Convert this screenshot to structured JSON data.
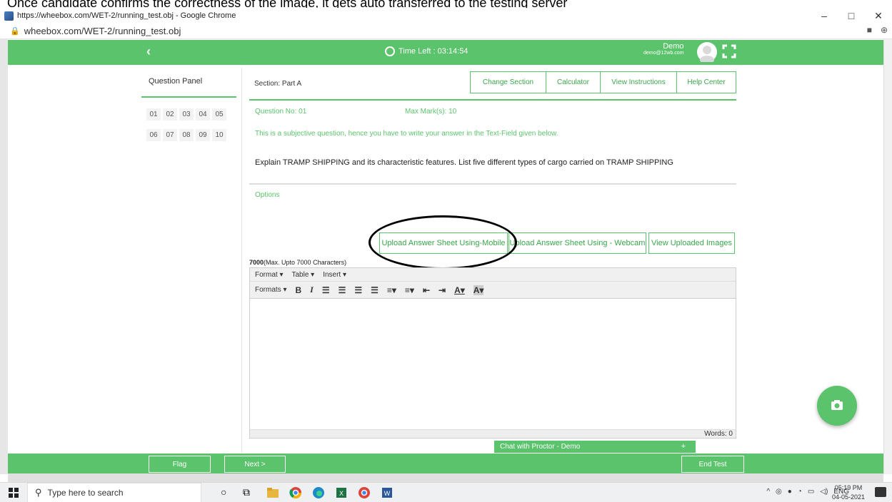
{
  "caption": "Once candidate confirms the correctness of the image, it gets auto transferred to the testing server",
  "window": {
    "title": "https://wheebox.com/WET-2/running_test.obj - Google Chrome",
    "minimize": "–",
    "maximize": "□",
    "close": "✕"
  },
  "address": {
    "url": "wheebox.com/WET-2/running_test.obj"
  },
  "header": {
    "back": "‹",
    "timer_label": "Time Left : 03:14:54",
    "user_name": "Demo",
    "user_email": "demo@12wb.com"
  },
  "question_panel": {
    "title": "Question Panel",
    "numbers": [
      "01",
      "02",
      "03",
      "04",
      "05",
      "06",
      "07",
      "08",
      "09",
      "10"
    ]
  },
  "section": {
    "label": "Section: Part A"
  },
  "top_buttons": {
    "change_section": "Change Section",
    "calculator": "Calculator",
    "view_instructions": "View Instructions",
    "help_center": "Help Center"
  },
  "question": {
    "number": "Question No: 01",
    "max_marks": "Max Mark(s): 10",
    "subjective_note": "This is a subjective question, hence you have to write your answer in the Text-Field given below.",
    "text": "Explain TRAMP SHIPPING and its characteristic features. List five different types of cargo carried on TRAMP SHIPPING",
    "options_label": "Options"
  },
  "upload": {
    "mobile": "Upload Answer Sheet Using-Mobile",
    "webcam": "Upload Answer Sheet Using - Webcam",
    "view": "View Uploaded Images"
  },
  "editor": {
    "char_count": "7000",
    "char_limit": "(Max. Upto 7000 Characters)",
    "menu_format": "Format ▾",
    "menu_table": "Table ▾",
    "menu_insert": "Insert ▾",
    "formats": "Formats ▾",
    "bold": "B",
    "italic": "I",
    "words": "Words: 0"
  },
  "chat": {
    "label": "Chat with Proctor - Demo",
    "toggle": "+"
  },
  "footer": {
    "flag": "Flag",
    "next": "Next >",
    "end_test": "End Test"
  },
  "taskbar": {
    "search_placeholder": "Type here to search",
    "lang": "ENG",
    "time": "05:19 PM",
    "date": "04-05-2021"
  },
  "colors": {
    "accent": "#5bc36b",
    "accent_text": "#3aa54c"
  }
}
